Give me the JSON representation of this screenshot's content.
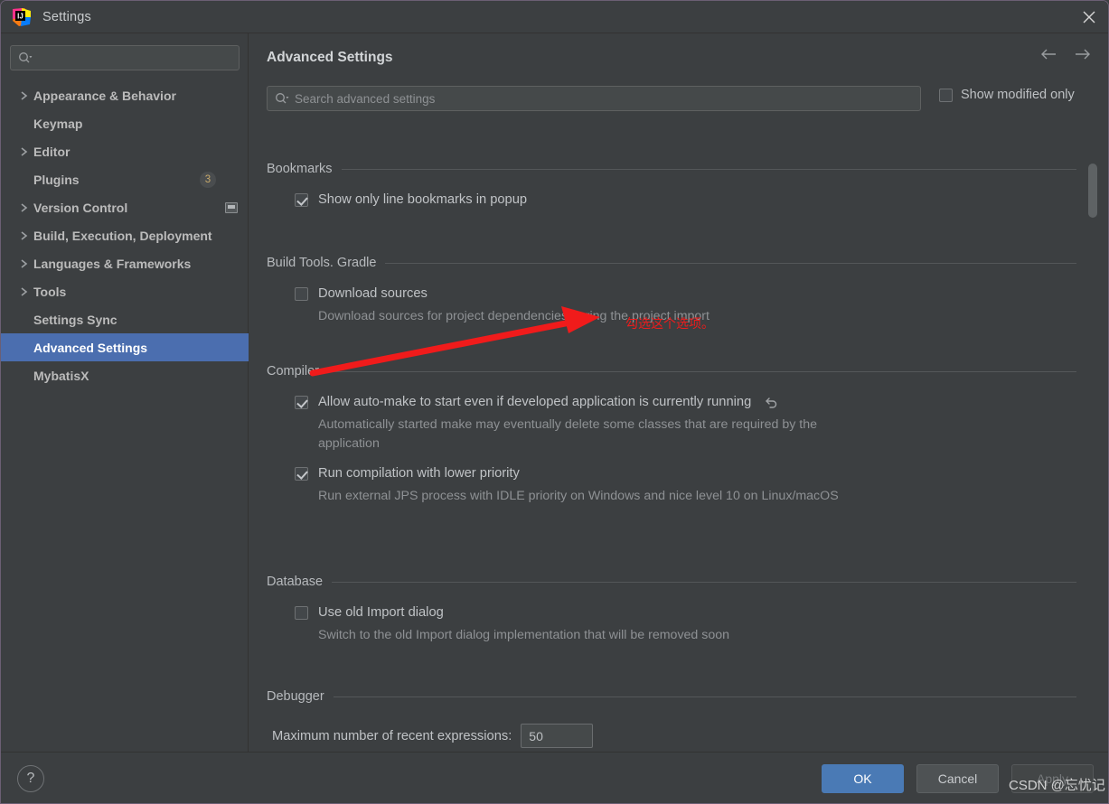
{
  "window": {
    "title": "Settings",
    "app_icon": "intellij-idea-logo",
    "close_icon": "close-icon",
    "accent_color": "#4b6eaf",
    "background_color": "#3c3f41"
  },
  "sidebar": {
    "search": {
      "value": "",
      "placeholder": "",
      "icon": "search-icon"
    },
    "items": [
      {
        "label": "Appearance & Behavior",
        "expandable": true,
        "selected": false
      },
      {
        "label": "Keymap",
        "expandable": false,
        "selected": false
      },
      {
        "label": "Editor",
        "expandable": true,
        "selected": false
      },
      {
        "label": "Plugins",
        "expandable": false,
        "selected": false,
        "badge": "3"
      },
      {
        "label": "Version Control",
        "expandable": true,
        "selected": false,
        "trailing_icon": "project-scope-icon"
      },
      {
        "label": "Build, Execution, Deployment",
        "expandable": true,
        "selected": false
      },
      {
        "label": "Languages & Frameworks",
        "expandable": true,
        "selected": false
      },
      {
        "label": "Tools",
        "expandable": true,
        "selected": false
      },
      {
        "label": "Settings Sync",
        "expandable": false,
        "selected": false
      },
      {
        "label": "Advanced Settings",
        "expandable": false,
        "selected": true
      },
      {
        "label": "MybatisX",
        "expandable": false,
        "selected": false
      }
    ]
  },
  "main": {
    "title": "Advanced Settings",
    "back_icon": "arrow-left-icon",
    "forward_icon": "arrow-right-icon",
    "search": {
      "value": "",
      "placeholder": "Search advanced settings",
      "icon": "search-icon"
    },
    "show_modified_only": {
      "label": "Show modified only",
      "checked": false
    },
    "sections": [
      {
        "name": "Bookmarks",
        "options": [
          {
            "label": "Show only line bookmarks in popup",
            "checked": true,
            "description": ""
          }
        ]
      },
      {
        "name": "Build Tools. Gradle",
        "options": [
          {
            "label": "Download sources",
            "checked": false,
            "description": "Download sources for project dependencies during the project import"
          }
        ]
      },
      {
        "name": "Compiler",
        "options": [
          {
            "label": "Allow auto-make to start even if developed application is currently running",
            "checked": true,
            "modified": true,
            "revert_icon": "revert-icon",
            "description": "Automatically started make may eventually delete some classes that are required by the application"
          },
          {
            "label": "Run compilation with lower priority",
            "checked": true,
            "description": "Run external JPS process with IDLE priority on Windows and nice level 10 on Linux/macOS"
          }
        ]
      },
      {
        "name": "Database",
        "options": [
          {
            "label": "Use old Import dialog",
            "checked": false,
            "description": "Switch to the old Import dialog implementation that will be removed soon"
          }
        ]
      },
      {
        "name": "Debugger",
        "spinner": {
          "label": "Maximum number of recent expressions:",
          "value": "50"
        }
      }
    ]
  },
  "annotation": {
    "text": "勾选这个选项。",
    "color": "#ee1c1c",
    "arrow_icon": "red-arrow-annotation"
  },
  "footer": {
    "help_label": "?",
    "help_icon": "help-icon",
    "ok_label": "OK",
    "cancel_label": "Cancel",
    "apply_label": "Apply",
    "apply_enabled": false
  },
  "watermark": {
    "text": "CSDN @忘忧记"
  }
}
